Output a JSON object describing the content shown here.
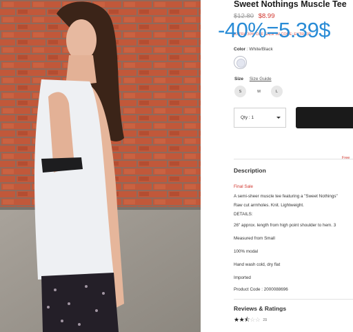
{
  "product": {
    "title": "Sweet Nothings Muscle Tee",
    "price_original": "$12.80",
    "price_sale": "$8.99",
    "promo_text": "EXTRA 30% OFF SALE W/ CODE: EXTRA30",
    "overlay_text": "-40%=5.39$"
  },
  "options": {
    "color_label": "Color",
    "color_value": "White/Black",
    "size_label": "Size",
    "size_guide": "Size Guide",
    "sizes": [
      "S",
      "M",
      "L"
    ],
    "qty_label": "Qty : 1"
  },
  "shipping": {
    "free_text": "Free"
  },
  "description": {
    "heading": "Description",
    "lines": [
      "Final Sale",
      "A semi-sheer muscle tee featuring a \"Sweet Nothings\"",
      "Raw cut armholes. Knit. Lightweight.",
      "DETAILS:",
      "26\" approx. length from high point shoulder to hem. 3",
      "Measured from Small",
      "100% modal",
      "Hand wash cold, dry flat",
      "Imported",
      "Product Code : 2000088696"
    ]
  },
  "reviews": {
    "heading": "Reviews & Ratings",
    "rating": 2.5,
    "score": "2.5"
  },
  "colors": {
    "sale_red": "#d0342c",
    "overlay_blue": "#2a8cd6",
    "add_to_bag": "#1a1a1a"
  }
}
